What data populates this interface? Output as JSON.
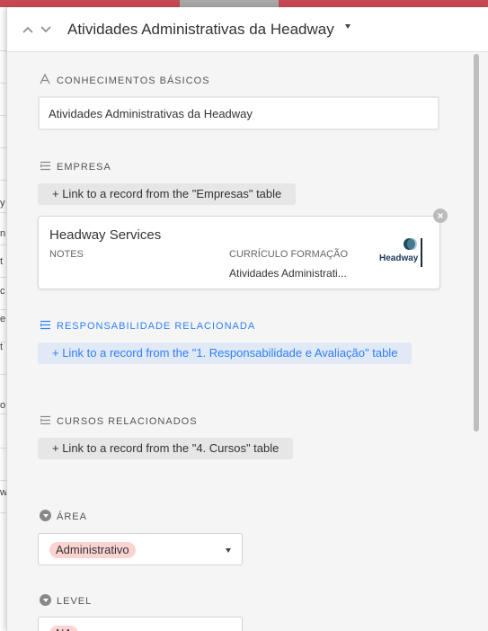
{
  "record": {
    "title": "Atividades Administrativas da Headway",
    "nav_up_icon": "chevron-up-icon",
    "nav_down_icon": "chevron-down-icon"
  },
  "background_grid": {
    "row_chars": [
      "y",
      "n",
      "t",
      "c",
      "e",
      "t",
      "o",
      "w"
    ]
  },
  "fields": {
    "conhecimentos": {
      "label": "CONHECIMENTOS BÁSICOS",
      "icon": "text-field-icon",
      "value": "Atividades Administrativas da Headway"
    },
    "empresa": {
      "label": "EMPRESA",
      "icon": "linked-record-icon",
      "link_button": "+ Link to a record from the \"Empresas\" table",
      "card": {
        "name": "Headway Services",
        "col1_header": "NOTES",
        "col1_value": "",
        "col2_header": "CURRÍCULO FORMAÇÃO",
        "col2_value": "Atividades Administrati...",
        "logo_text": "Headway",
        "remove_icon": "close-icon"
      }
    },
    "responsabilidade": {
      "label": "RESPONSABILIDADE RELACIONADA",
      "icon": "linked-record-icon",
      "color": "#2d7ff9",
      "link_button": "+ Link to a record from the \"1. Responsabilidade e Avaliação\" table"
    },
    "cursos": {
      "label": "CURSOS RELACIONADOS",
      "icon": "linked-record-icon",
      "link_button": "+ Link to a record from the \"4. Cursos\" table"
    },
    "area": {
      "label": "ÁREA",
      "icon": "single-select-icon",
      "value": "Administrativo",
      "pill_color": "#fbd4d2"
    },
    "level": {
      "label": "LEVEL",
      "icon": "single-select-icon",
      "value": "NA",
      "pill_color": "#fbd4d2"
    }
  }
}
